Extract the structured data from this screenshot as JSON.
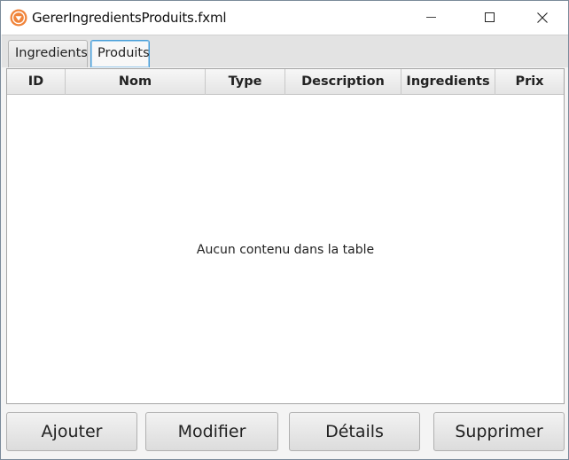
{
  "window": {
    "title": "GererIngredientsProduits.fxml",
    "icon": "app-shield-icon"
  },
  "tabs": [
    {
      "label": "Ingredients",
      "selected": false
    },
    {
      "label": "Produits",
      "selected": true
    }
  ],
  "table": {
    "columns": [
      "ID",
      "Nom",
      "Type",
      "Description",
      "Ingredients",
      "Prix"
    ],
    "rows": [],
    "empty_message": "Aucun contenu dans la table"
  },
  "actions": {
    "add": "Ajouter",
    "edit": "Modifier",
    "details": "Détails",
    "delete": "Supprimer"
  },
  "colors": {
    "selected_tab_border": "#4a9fd8",
    "app_icon": "#f0843a"
  }
}
